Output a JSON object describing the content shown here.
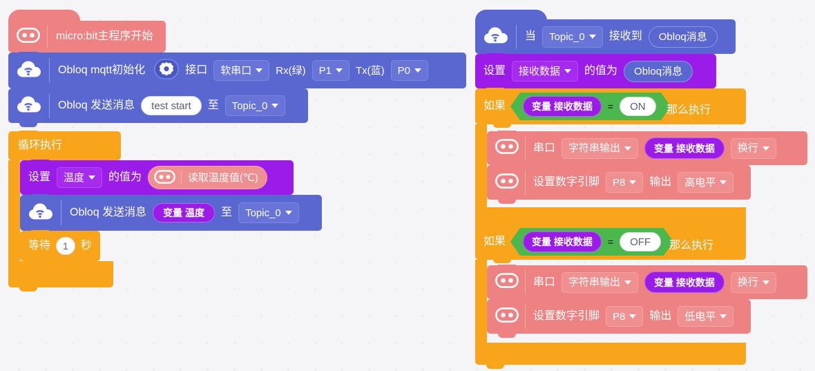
{
  "app": {
    "kind": "block-programming-canvas",
    "background_color": "#f5f5f7",
    "grid_dot_color": "#e2e2e4"
  },
  "colors": {
    "microbit": "#ee8282",
    "obloq": "#5b67d0",
    "loop": "#f8a51b",
    "variable": "#9b1ce8",
    "logic": "#4cb74c",
    "text": "#ffffff"
  },
  "scripts": {
    "main_program": {
      "hat": {
        "label": "micro:bit主程序开始",
        "icon": "microbit-icon"
      },
      "mqtt_init": {
        "icon": "obloq-cloud-icon",
        "label": "Obloq mqtt初始化",
        "gear_icon": "gear-icon",
        "interface_label": "接口",
        "interface_value": "软串口",
        "rx_label": "Rx(绿)",
        "rx_value": "P1",
        "tx_label": "Tx(蓝)",
        "tx_value": "P0"
      },
      "send_start": {
        "icon": "obloq-cloud-icon",
        "label": "Obloq 发送消息",
        "message": "test start",
        "to_label": "至",
        "topic": "Topic_0"
      },
      "forever": {
        "label": "循环执行",
        "set_temp": {
          "set_label": "设置",
          "variable": "温度",
          "value_label": "的值为",
          "reporter_icon": "microbit-icon",
          "reporter_label": "读取温度值(℃)"
        },
        "send_temp": {
          "icon": "obloq-cloud-icon",
          "label": "Obloq 发送消息",
          "value": "变量 温度",
          "to_label": "至",
          "topic": "Topic_0"
        },
        "wait": {
          "prefix": "等待",
          "seconds": "1",
          "suffix": "秒"
        }
      }
    },
    "on_message": {
      "hat": {
        "icon": "obloq-cloud-icon",
        "when_label": "当",
        "topic": "Topic_0",
        "received_label": "接收到",
        "message_reporter": "Obloq消息"
      },
      "set_recv": {
        "set_label": "设置",
        "variable": "接收数据",
        "value_label": "的值为",
        "reporter": "Obloq消息"
      },
      "branches": [
        {
          "if_label": "如果",
          "operand_left": "变量 接收数据",
          "operator": "=",
          "operand_right": "ON",
          "then_label": "那么执行",
          "serial": {
            "icon": "microbit-icon",
            "label": "串口",
            "mode": "字符串输出",
            "value": "变量 接收数据",
            "newline": "换行"
          },
          "pin": {
            "icon": "microbit-icon",
            "label": "设置数字引脚",
            "pin": "P8",
            "output_label": "输出",
            "level": "高电平"
          }
        },
        {
          "if_label": "如果",
          "operand_left": "变量 接收数据",
          "operator": "=",
          "operand_right": "OFF",
          "then_label": "那么执行",
          "serial": {
            "icon": "microbit-icon",
            "label": "串口",
            "mode": "字符串输出",
            "value": "变量 接收数据",
            "newline": "换行"
          },
          "pin": {
            "icon": "microbit-icon",
            "label": "设置数字引脚",
            "pin": "P8",
            "output_label": "输出",
            "level": "低电平"
          }
        }
      ]
    }
  }
}
